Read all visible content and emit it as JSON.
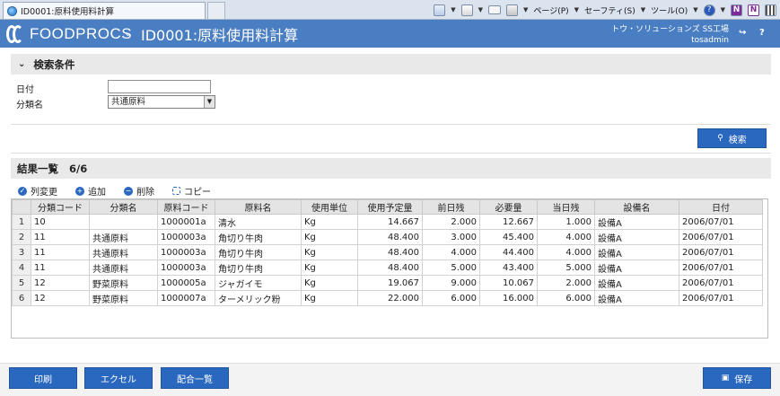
{
  "browser": {
    "tab_title": "ID0001:原料使用料計算",
    "commands": [
      "ページ(P)",
      "セーフティ(S)",
      "ツール(O)"
    ]
  },
  "header": {
    "logo_text": "FOODPROCS",
    "title": "ID0001:原料使用料計算",
    "company": "トウ・ソリューションズ SS工場",
    "user": "tosadmin",
    "bg_color": "#4a7ec2"
  },
  "search": {
    "title": "検索条件",
    "date_label": "日付",
    "date_value": "",
    "category_label": "分類名",
    "category_value": "共通原料",
    "search_button": "検索"
  },
  "results": {
    "title": "結果一覧",
    "count": "6/6",
    "toolbar": {
      "change_columns": "列変更",
      "add": "追加",
      "delete": "削除",
      "copy": "コピー"
    },
    "columns": [
      "分類コード",
      "分類名",
      "原料コード",
      "原料名",
      "使用単位",
      "使用予定量",
      "前日残",
      "必要量",
      "当日残",
      "設備名",
      "日付"
    ],
    "rows": [
      {
        "n": "1",
        "cells": [
          "10",
          "",
          "1000001a",
          "清水",
          "Kg",
          "14.667",
          "2.000",
          "12.667",
          "1.000",
          "設備A",
          "2006/07/01"
        ]
      },
      {
        "n": "2",
        "cells": [
          "11",
          "共通原料",
          "1000003a",
          "角切り牛肉",
          "Kg",
          "48.400",
          "3.000",
          "45.400",
          "4.000",
          "設備A",
          "2006/07/01"
        ]
      },
      {
        "n": "3",
        "cells": [
          "11",
          "共通原料",
          "1000003a",
          "角切り牛肉",
          "Kg",
          "48.400",
          "4.000",
          "44.400",
          "4.000",
          "設備A",
          "2006/07/01"
        ]
      },
      {
        "n": "4",
        "cells": [
          "11",
          "共通原料",
          "1000003a",
          "角切り牛肉",
          "Kg",
          "48.400",
          "5.000",
          "43.400",
          "5.000",
          "設備A",
          "2006/07/01"
        ]
      },
      {
        "n": "5",
        "cells": [
          "12",
          "野菜原料",
          "1000005a",
          "ジャガイモ",
          "Kg",
          "19.067",
          "9.000",
          "10.067",
          "2.000",
          "設備A",
          "2006/07/01"
        ]
      },
      {
        "n": "6",
        "cells": [
          "12",
          "野菜原料",
          "1000007a",
          "ターメリック粉",
          "Kg",
          "22.000",
          "6.000",
          "16.000",
          "6.000",
          "設備A",
          "2006/07/01"
        ]
      }
    ]
  },
  "footer": {
    "print": "印刷",
    "excel": "エクセル",
    "recipe_list": "配合一覧",
    "save": "保存"
  }
}
